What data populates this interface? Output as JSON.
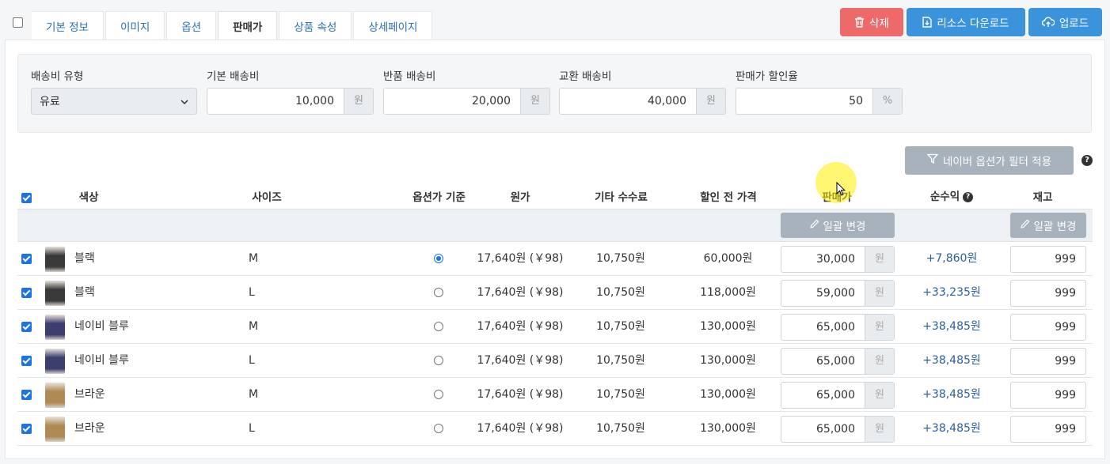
{
  "tabs": [
    "기본 정보",
    "이미지",
    "옵션",
    "판매가",
    "상품 속성",
    "상세페이지"
  ],
  "active_tab_index": 3,
  "actions": {
    "delete_label": "삭제",
    "download_label": "리소스 다운로드",
    "upload_label": "업로드",
    "delete_color": "#ee6a6a",
    "primary_color": "#3a93db"
  },
  "shipping": {
    "type_label": "배송비 유형",
    "type_value": "유료",
    "base_label": "기본 배송비",
    "base_value": "10,000",
    "return_label": "반품 배송비",
    "return_value": "20,000",
    "exchange_label": "교환 배송비",
    "exchange_value": "40,000",
    "discount_label": "판매가 할인율",
    "discount_value": "50",
    "unit_won": "원",
    "unit_percent": "%"
  },
  "naver_filter_label": "네이버 옵션가 필터 적용",
  "table": {
    "headers": {
      "color": "색상",
      "size": "사이즈",
      "option_base": "옵션가 기준",
      "cost": "원가",
      "fee": "기타 수수료",
      "pre_discount": "할인 전 가격",
      "sale_price": "판매가",
      "net_profit": "순수익",
      "stock": "재고"
    },
    "bulk_change_label": "일괄 변경",
    "rows": [
      {
        "color": "블랙",
        "size": "M",
        "selected": true,
        "cost": "17,640원 (￥98)",
        "fee": "10,750원",
        "pre_discount": "60,000원",
        "sale_price": "30,000",
        "unit": "원",
        "profit": "+7,860원",
        "stock": "999",
        "thumb_color": "#3a3a3a"
      },
      {
        "color": "블랙",
        "size": "L",
        "selected": false,
        "cost": "17,640원 (￥98)",
        "fee": "10,750원",
        "pre_discount": "118,000원",
        "sale_price": "59,000",
        "unit": "원",
        "profit": "+33,235원",
        "stock": "999",
        "thumb_color": "#3a3a3a"
      },
      {
        "color": "네이비 블루",
        "size": "M",
        "selected": false,
        "cost": "17,640원 (￥98)",
        "fee": "10,750원",
        "pre_discount": "130,000원",
        "sale_price": "65,000",
        "unit": "원",
        "profit": "+38,485원",
        "stock": "999",
        "thumb_color": "#3c3f6e"
      },
      {
        "color": "네이비 블루",
        "size": "L",
        "selected": false,
        "cost": "17,640원 (￥98)",
        "fee": "10,750원",
        "pre_discount": "130,000원",
        "sale_price": "65,000",
        "unit": "원",
        "profit": "+38,485원",
        "stock": "999",
        "thumb_color": "#3c3f6e"
      },
      {
        "color": "브라운",
        "size": "M",
        "selected": false,
        "cost": "17,640원 (￥98)",
        "fee": "10,750원",
        "pre_discount": "130,000원",
        "sale_price": "65,000",
        "unit": "원",
        "profit": "+38,485원",
        "stock": "999",
        "thumb_color": "#b08a55"
      },
      {
        "color": "브라운",
        "size": "L",
        "selected": false,
        "cost": "17,640원 (￥98)",
        "fee": "10,750원",
        "pre_discount": "130,000원",
        "sale_price": "65,000",
        "unit": "원",
        "profit": "+38,485원",
        "stock": "999",
        "thumb_color": "#b08a55"
      }
    ]
  }
}
